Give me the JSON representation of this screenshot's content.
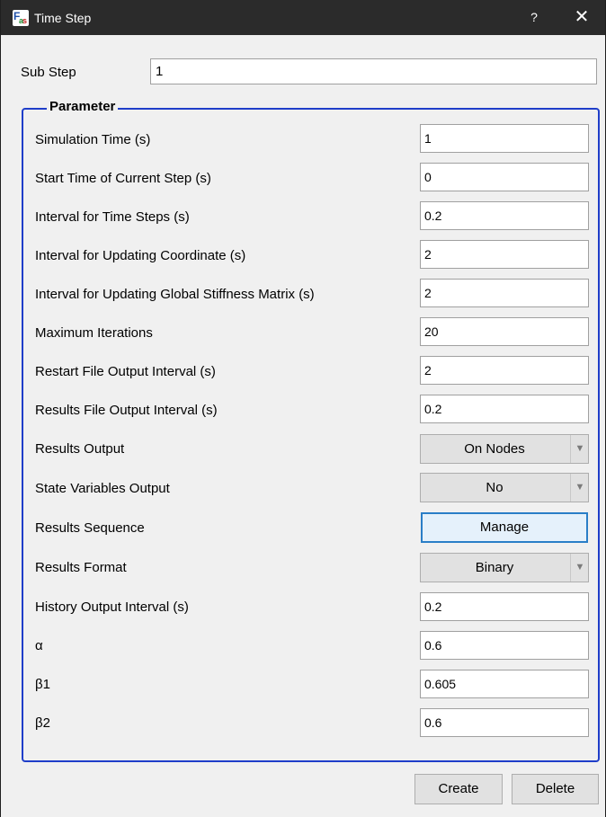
{
  "window": {
    "title": "Time Step",
    "help_label": "?",
    "close_label": "✕",
    "icon": "app-logo-icon",
    "icon_letters": [
      "F",
      "a",
      "s"
    ]
  },
  "sub_step": {
    "label": "Sub Step",
    "value": "1"
  },
  "parameter": {
    "title": "Parameter",
    "simulation_time": {
      "label": "Simulation Time (s)",
      "value": "1"
    },
    "start_time": {
      "label": "Start Time of Current Step (s)",
      "value": "0"
    },
    "interval_time_steps": {
      "label": "Interval for Time Steps (s)",
      "value": "0.2"
    },
    "interval_updating_coordinate": {
      "label": "Interval for Updating Coordinate (s)",
      "value": "2"
    },
    "interval_updating_stiffness": {
      "label": "Interval for Updating Global Stiffness Matrix (s)",
      "value": "2"
    },
    "maximum_iterations": {
      "label": "Maximum Iterations",
      "value": "20"
    },
    "restart_file_output_interval": {
      "label": "Restart File Output Interval (s)",
      "value": "2"
    },
    "results_file_output_interval": {
      "label": "Results File Output Interval (s)",
      "value": "0.2"
    },
    "results_output": {
      "label": "Results Output",
      "value": "On Nodes"
    },
    "state_variables_output": {
      "label": "State Variables Output",
      "value": "No"
    },
    "results_sequence": {
      "label": "Results Sequence",
      "button": "Manage"
    },
    "results_format": {
      "label": "Results Format",
      "value": "Binary"
    },
    "history_output_interval": {
      "label": "History Output Interval (s)",
      "value": "0.2"
    },
    "alpha": {
      "label": "α",
      "value": "0.6"
    },
    "beta1": {
      "label": "β1",
      "value": "0.605"
    },
    "beta2": {
      "label": "β2",
      "value": "0.6"
    }
  },
  "footer": {
    "create_label": "Create",
    "delete_label": "Delete"
  },
  "colors": {
    "titlebar": "#2b2b2b",
    "group_border": "#1f3ec9",
    "focus_border": "#2a7ec7",
    "window_bg": "#f0f0f0"
  }
}
